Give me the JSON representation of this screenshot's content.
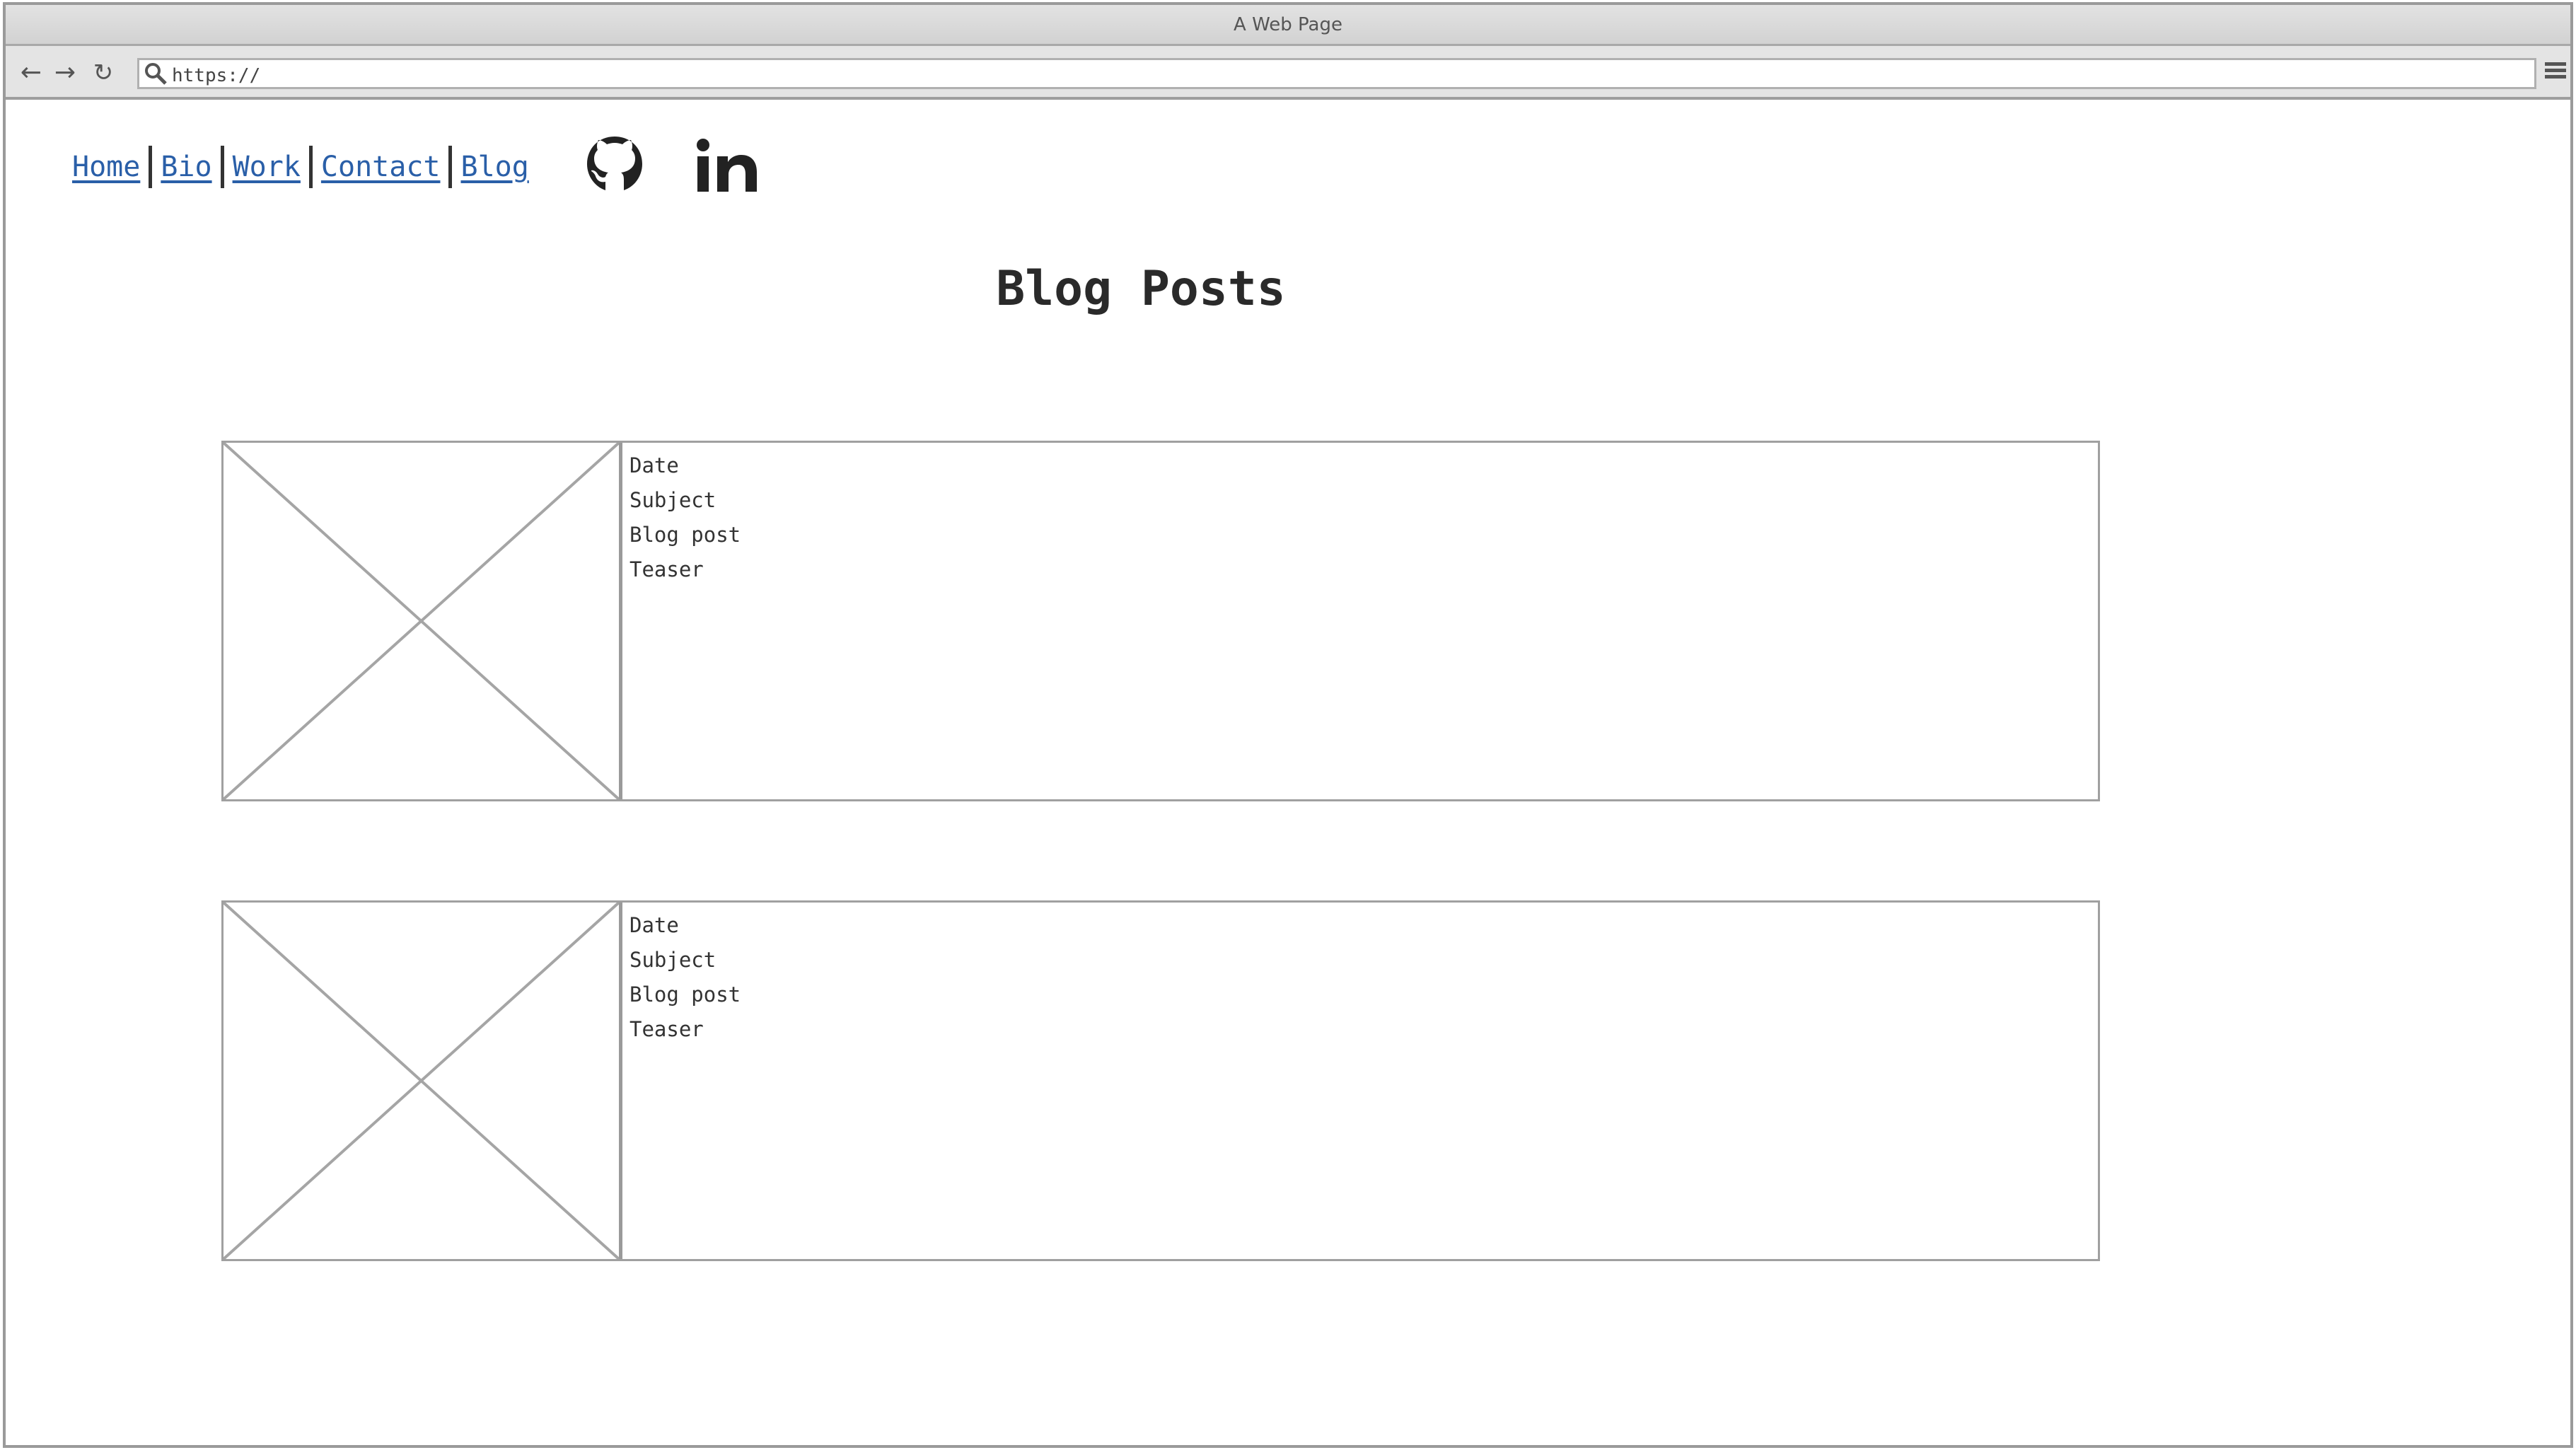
{
  "window": {
    "title": "A Web Page"
  },
  "browser": {
    "url": "https://",
    "back_icon": "arrow-left-icon",
    "forward_icon": "arrow-right-icon",
    "reload_icon": "reload-icon",
    "menu_icon": "hamburger-menu-icon"
  },
  "site_nav": {
    "links": [
      {
        "label": "Home"
      },
      {
        "label": "Bio"
      },
      {
        "label": "Work"
      },
      {
        "label": "Contact"
      },
      {
        "label": "Blog"
      }
    ]
  },
  "social": {
    "icons": [
      "github-icon",
      "linkedin-icon"
    ]
  },
  "main": {
    "title": "Blog Posts",
    "posts": [
      {
        "date": "Date",
        "subject": "Subject",
        "body": "Blog post",
        "teaser": "Teaser"
      },
      {
        "date": "Date",
        "subject": "Subject",
        "body": "Blog post",
        "teaser": "Teaser"
      }
    ]
  },
  "colors": {
    "link": "#2a5fa8",
    "border": "#a0a0a0",
    "chrome": "#e4e4e4"
  }
}
